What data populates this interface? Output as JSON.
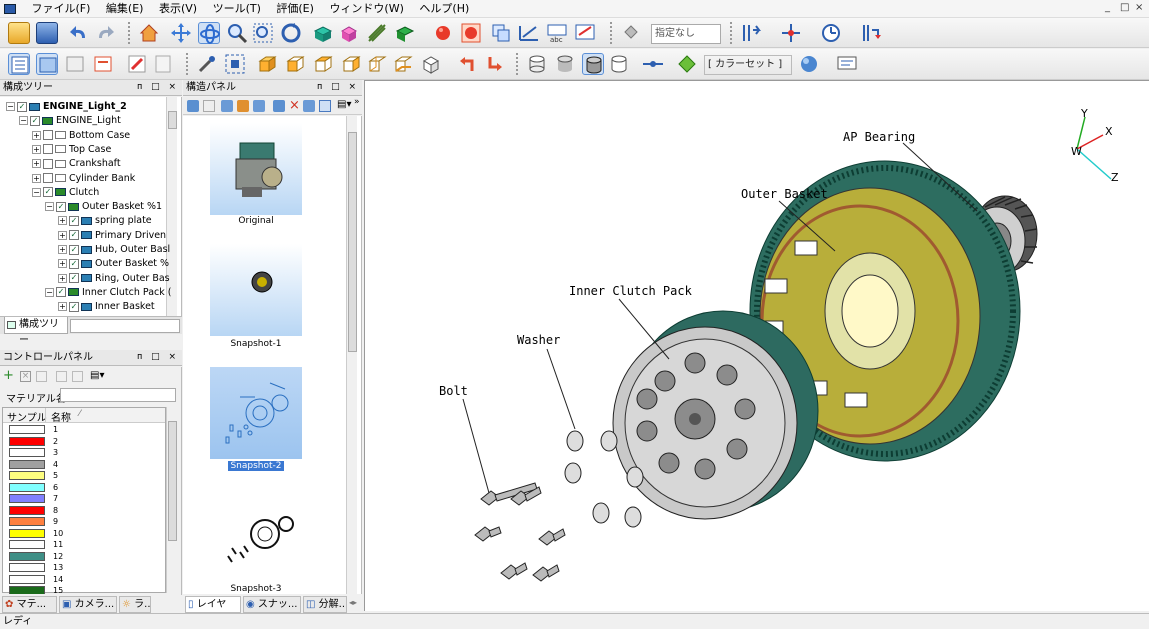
{
  "menu": [
    "ファイル(F)",
    "編集(E)",
    "表示(V)",
    "ツール(T)",
    "評価(E)",
    "ウィンドウ(W)",
    "ヘルプ(H)"
  ],
  "window_controls": [
    "_",
    "□",
    "×"
  ],
  "toolbar": {
    "style_combo": "指定なし",
    "color_set_combo": "[ カラーセット ]"
  },
  "tree_panel": {
    "title": "構成ツリー",
    "tab_label": "構成ツリー",
    "items": [
      {
        "label": "ENGINE_Light_2",
        "level": 0,
        "checked": true,
        "icon": "assembly-root-icon"
      },
      {
        "label": "ENGINE_Light",
        "level": 1,
        "checked": true,
        "icon": "assembly-icon"
      },
      {
        "label": "Bottom Case",
        "level": 2,
        "checked": false,
        "icon": "part-icon"
      },
      {
        "label": "Top Case",
        "level": 2,
        "checked": false,
        "icon": "part-icon"
      },
      {
        "label": "Crankshaft",
        "level": 2,
        "checked": false,
        "icon": "part-icon"
      },
      {
        "label": "Cylinder Bank",
        "level": 2,
        "checked": false,
        "icon": "part-icon"
      },
      {
        "label": "Clutch",
        "level": 2,
        "checked": true,
        "icon": "assembly-icon"
      },
      {
        "label": "Outer Basket %1",
        "level": 3,
        "checked": true,
        "icon": "assembly-icon"
      },
      {
        "label": "spring plate",
        "level": 4,
        "checked": true,
        "icon": "part-icon"
      },
      {
        "label": "Primary Driven",
        "level": 4,
        "checked": true,
        "icon": "part-icon"
      },
      {
        "label": "Hub, Outer Basl",
        "level": 4,
        "checked": true,
        "icon": "part-icon"
      },
      {
        "label": "Outer Basket %",
        "level": 4,
        "checked": true,
        "icon": "part-icon"
      },
      {
        "label": "Ring, Outer Bas",
        "level": 4,
        "checked": true,
        "icon": "part-icon"
      },
      {
        "label": "Inner Clutch Pack (",
        "level": 3,
        "checked": true,
        "icon": "assembly-icon"
      },
      {
        "label": "Inner Basket",
        "level": 4,
        "checked": true,
        "icon": "part-icon"
      }
    ]
  },
  "control_panel": {
    "title": "コントロールパネル",
    "material_name_label": "マテリアル名",
    "col_sample": "サンプル",
    "col_name": "名称",
    "materials": [
      {
        "name": "1",
        "color": "#ffffff"
      },
      {
        "name": "2",
        "color": "#ff0000"
      },
      {
        "name": "3",
        "color": "#ffffff"
      },
      {
        "name": "4",
        "color": "#a0a0a0"
      },
      {
        "name": "5",
        "color": "#ffff80"
      },
      {
        "name": "6",
        "color": "#80ffff"
      },
      {
        "name": "7",
        "color": "#8080ff"
      },
      {
        "name": "8",
        "color": "#ff0000"
      },
      {
        "name": "9",
        "color": "#ff8040"
      },
      {
        "name": "10",
        "color": "#ffff00"
      },
      {
        "name": "11",
        "color": "#ffffff"
      },
      {
        "name": "12",
        "color": "#3f8f86"
      },
      {
        "name": "13",
        "color": "#ffffff"
      },
      {
        "name": "14",
        "color": "#ffffff"
      },
      {
        "name": "15",
        "color": "#1a6a1a"
      }
    ]
  },
  "structure_panel": {
    "title": "構造パネル",
    "snapshots": [
      {
        "label": "Original",
        "selected": false
      },
      {
        "label": "Snapshot-1",
        "selected": false
      },
      {
        "label": "Snapshot-2",
        "selected": true
      },
      {
        "label": "Snapshot-3",
        "selected": false
      }
    ]
  },
  "bottom_tabs": [
    "マテ...",
    "カメラ...",
    "ラ...",
    "レイヤ",
    "スナッ...",
    "分解..."
  ],
  "viewport": {
    "callouts": [
      "AP Bearing",
      "Outer Basket",
      "Inner Clutch Pack",
      "Washer",
      "Bolt"
    ],
    "axes": [
      "Y",
      "X",
      "W",
      "Z"
    ]
  },
  "status": "レディ"
}
